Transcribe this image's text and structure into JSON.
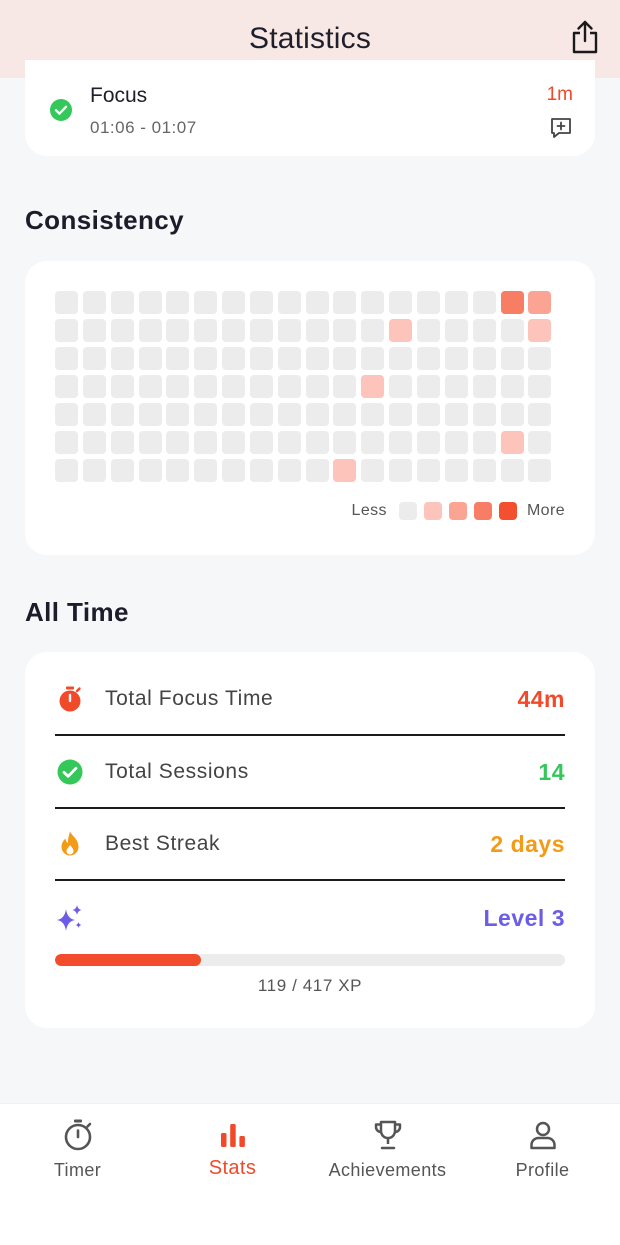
{
  "header": {
    "title": "Statistics",
    "share_icon": "share-icon"
  },
  "session": {
    "name": "Focus",
    "time_range": "01:06 - 01:07",
    "duration": "1m",
    "status_icon": "check-circle-icon",
    "note_icon": "add-note-icon"
  },
  "consistency": {
    "title": "Consistency",
    "weeks": 18,
    "days": 7,
    "levels": [
      [
        0,
        0,
        0,
        0,
        0,
        0,
        0,
        0,
        0,
        0,
        0,
        0,
        0,
        0,
        0,
        0,
        3,
        2
      ],
      [
        0,
        0,
        0,
        0,
        0,
        0,
        0,
        0,
        0,
        0,
        0,
        0,
        1,
        0,
        0,
        0,
        0,
        1
      ],
      [
        0,
        0,
        0,
        0,
        0,
        0,
        0,
        0,
        0,
        0,
        0,
        0,
        0,
        0,
        0,
        0,
        0,
        0
      ],
      [
        0,
        0,
        0,
        0,
        0,
        0,
        0,
        0,
        0,
        0,
        0,
        1,
        0,
        0,
        0,
        0,
        0,
        0
      ],
      [
        0,
        0,
        0,
        0,
        0,
        0,
        0,
        0,
        0,
        0,
        0,
        0,
        0,
        0,
        0,
        0,
        0,
        0
      ],
      [
        0,
        0,
        0,
        0,
        0,
        0,
        0,
        0,
        0,
        0,
        0,
        0,
        0,
        0,
        0,
        0,
        1,
        0
      ],
      [
        0,
        0,
        0,
        0,
        0,
        0,
        0,
        0,
        0,
        0,
        1,
        0,
        0,
        0,
        0,
        0,
        0,
        0
      ]
    ],
    "level_colors": [
      "#ececec",
      "#fcc4bb",
      "#fba494",
      "#f77e65",
      "#f2502e"
    ],
    "legend_less": "Less",
    "legend_more": "More"
  },
  "all_time": {
    "title": "All Time",
    "rows": [
      {
        "label": "Total Focus Time",
        "value": "44m",
        "color": "#f04a2a",
        "icon": "stopwatch-icon"
      },
      {
        "label": "Total Sessions",
        "value": "14",
        "color": "#34c759",
        "icon": "check-circle-icon"
      },
      {
        "label": "Best Streak",
        "value": "2 days",
        "color": "#f39a16",
        "icon": "flame-icon"
      }
    ],
    "level": {
      "label": "Level 3",
      "color": "#6c5ce7",
      "icon": "sparkles-icon"
    },
    "xp": {
      "current": 119,
      "total": 417,
      "text": "119 / 417 XP"
    }
  },
  "tabs": [
    {
      "label": "Timer",
      "icon": "stopwatch-icon",
      "active": false
    },
    {
      "label": "Stats",
      "icon": "bar-chart-icon",
      "active": true
    },
    {
      "label": "Achievements",
      "icon": "trophy-icon",
      "active": false
    },
    {
      "label": "Profile",
      "icon": "person-icon",
      "active": false
    }
  ],
  "colors": {
    "accent": "#f04a2a",
    "header_bg": "#f8e8e5",
    "success": "#34c759",
    "streak": "#f39a16",
    "level": "#6c5ce7"
  }
}
